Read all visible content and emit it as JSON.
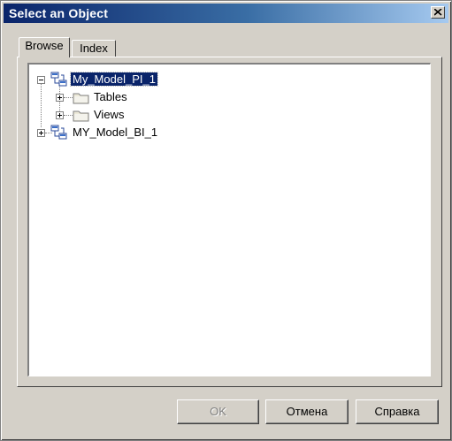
{
  "window": {
    "title": "Select an Object"
  },
  "tabs": [
    {
      "label": "Browse",
      "selected": true
    },
    {
      "label": "Index",
      "selected": false
    }
  ],
  "tree": {
    "nodes": [
      {
        "label": "My_Model_PI_1",
        "icon": "model-icon",
        "expanded": true,
        "selected": true,
        "children": [
          {
            "label": "Tables",
            "icon": "folder-icon",
            "expanded": false
          },
          {
            "label": "Views",
            "icon": "folder-icon",
            "expanded": false
          }
        ]
      },
      {
        "label": "MY_Model_BI_1",
        "icon": "model-icon",
        "expanded": false,
        "selected": false
      }
    ]
  },
  "buttons": {
    "ok": {
      "label": "OK",
      "enabled": false
    },
    "cancel": {
      "label": "Отмена",
      "enabled": true
    },
    "help": {
      "label": "Справка",
      "enabled": true
    }
  },
  "colors": {
    "selection": "#0a246a",
    "dialog_face": "#d4d0c8"
  }
}
